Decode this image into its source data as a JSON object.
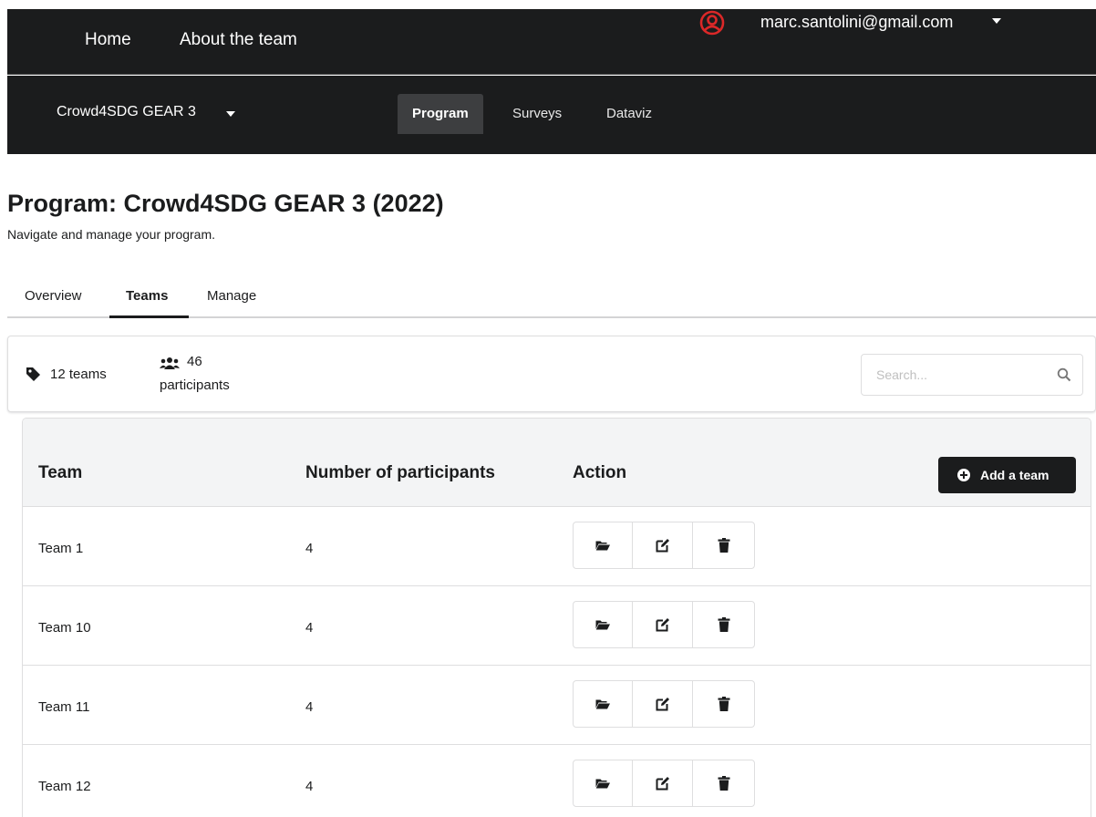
{
  "topnav": {
    "home": "Home",
    "about": "About the team",
    "user_email": "marc.santolini@gmail.com",
    "user_icon_color": "#db2828"
  },
  "subnav": {
    "program_select": "Crowd4SDG GEAR 3",
    "tabs": [
      {
        "label": "Program",
        "active": true
      },
      {
        "label": "Surveys",
        "active": false
      },
      {
        "label": "Dataviz",
        "active": false
      }
    ]
  },
  "page": {
    "title": "Program: Crowd4SDG GEAR 3 (2022)",
    "subtitle": "Navigate and manage your program."
  },
  "tabs": [
    {
      "label": "Overview",
      "active": false
    },
    {
      "label": "Teams",
      "active": true
    },
    {
      "label": "Manage",
      "active": false
    }
  ],
  "stats": {
    "teams": "12 teams",
    "participants_count": "46",
    "participants_label": "participants"
  },
  "search": {
    "placeholder": "Search...",
    "value": ""
  },
  "table": {
    "columns": [
      "Team",
      "Number of participants",
      "Action"
    ],
    "add_label": "Add a team",
    "rows": [
      {
        "team": "Team 1",
        "participants": "4"
      },
      {
        "team": "Team 10",
        "participants": "4"
      },
      {
        "team": "Team 11",
        "participants": "4"
      },
      {
        "team": "Team 12",
        "participants": "4"
      }
    ],
    "action_icons": [
      "folder-open-icon",
      "edit-icon",
      "trash-icon"
    ]
  },
  "colors": {
    "dark_bg": "#1b1c1d",
    "header_bg": "#f3f4f5",
    "border": "#dededf"
  }
}
